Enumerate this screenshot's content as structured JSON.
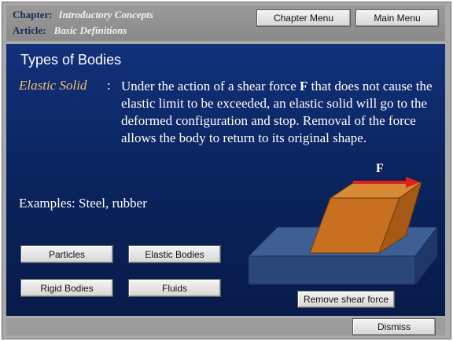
{
  "header": {
    "chapter_label": "Chapter:",
    "chapter_value": "Introductory Concepts",
    "article_label": "Article:",
    "article_value": "Basic Definitions",
    "chapter_menu_label": "Chapter Menu",
    "main_menu_label": "Main Menu"
  },
  "main": {
    "title": "Types of Bodies",
    "term": "Elastic Solid",
    "definition_pre": "Under the action of a shear force ",
    "definition_bold": "F",
    "definition_post": " that does not cause the elastic limit to be exceeded, an elastic solid will go to the deformed configuration and stop.  Removal of the force allows the body to return to its original shape.",
    "examples": "Examples:  Steel, rubber",
    "force_label": "F",
    "buttons": {
      "particles": "Particles",
      "elastic_bodies": "Elastic Bodies",
      "rigid_bodies": "Rigid Bodies",
      "fluids": "Fluids",
      "remove_shear_force": "Remove shear force"
    }
  },
  "footer": {
    "dismiss_label": "Dismiss"
  },
  "colors": {
    "background_blue": "#0b2560",
    "term_color": "#f2c66a",
    "block_orange": "#c66a1c",
    "base_blue": "#2e4f85",
    "force_arrow": "#e0201b"
  },
  "icons": {
    "force_arrow": "right-arrow-icon"
  }
}
